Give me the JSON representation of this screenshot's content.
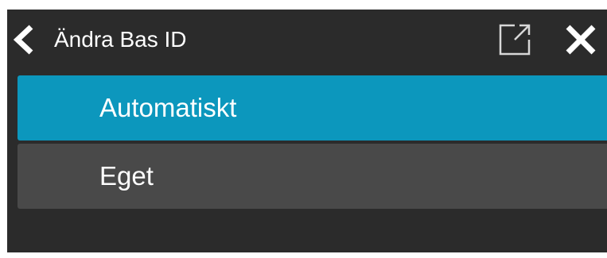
{
  "header": {
    "title": "Ändra Bas ID",
    "back_icon": "chevron-left-icon",
    "open_icon": "external-link-icon",
    "close_icon": "close-icon"
  },
  "menu": {
    "items": [
      {
        "label": "Automatiskt",
        "selected": true
      },
      {
        "label": "Eget",
        "selected": false
      }
    ]
  },
  "colors": {
    "background": "#2b2b2b",
    "selected": "#0c97bd",
    "item": "#494949",
    "text": "#ffffff"
  }
}
